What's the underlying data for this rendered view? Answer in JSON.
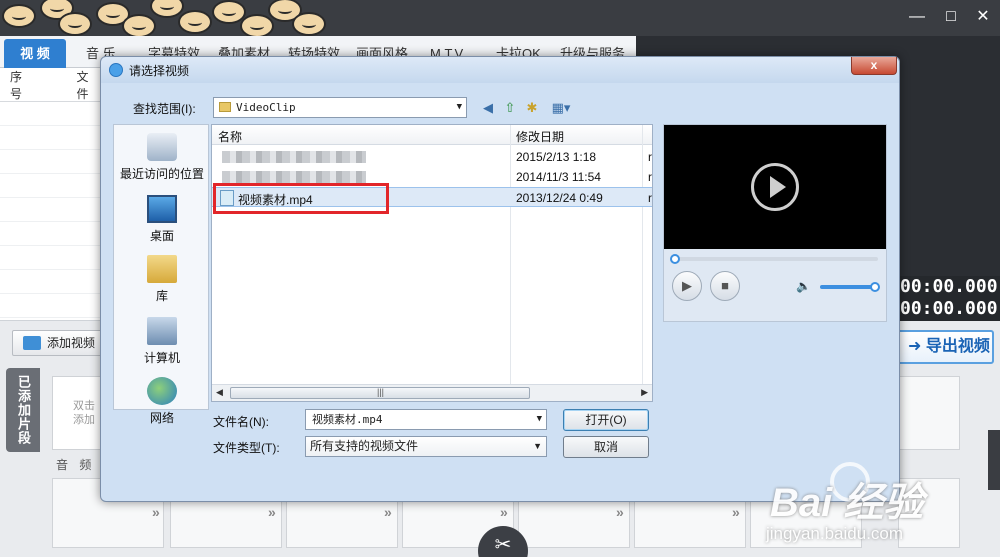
{
  "app": {
    "tabs": [
      "视 频",
      "音 乐",
      "字幕特效",
      "叠加素材",
      "转场特效",
      "画面风格",
      "M.T.V.",
      "卡拉OK",
      "升级与服务"
    ],
    "list_headers": [
      "序号",
      "文件"
    ],
    "time1": "00:00.000",
    "time2": "00:00.000",
    "add_video": "添加视频",
    "export_video": "导出视频",
    "added_clips": "已添加片段",
    "added_placeholder_1": "双击",
    "added_placeholder_2": "添加",
    "audio_label": "音 频",
    "window_controls": {
      "minimize": "minimize-icon",
      "maximize": "maximize-icon",
      "close": "close-icon"
    }
  },
  "dialog": {
    "title": "请选择视频",
    "close_label": "x",
    "look_in_label": "查找范围(I):",
    "look_in_value": "VideoClip",
    "places": [
      "最近访问的位置",
      "桌面",
      "库",
      "计算机",
      "网络"
    ],
    "columns": {
      "name": "名称",
      "modified": "修改日期"
    },
    "files": [
      {
        "name": "",
        "date": "2015/2/13 1:18",
        "extra": "r",
        "blurred": true
      },
      {
        "name": "",
        "date": "2014/11/3 11:54",
        "extra": "r",
        "blurred": true
      },
      {
        "name": "视频素材.mp4",
        "date": "2013/12/24 0:49",
        "extra": "r",
        "blurred": false,
        "selected": true
      }
    ],
    "file_name_label": "文件名(N):",
    "file_name_value": "视频素材.mp4",
    "file_type_label": "文件类型(T):",
    "file_type_value": "所有支持的视频文件",
    "open_button": "打开(O)",
    "cancel_button": "取消",
    "seek_progress": 0.0,
    "volume_level": 1.0
  },
  "watermark": {
    "main": "Bai 经验",
    "sub": "jingyan.baidu.com"
  },
  "colors": {
    "accent": "#2f7fd0",
    "highlight_box": "#e2262a",
    "dialog_bg": "#cfe0f3"
  }
}
